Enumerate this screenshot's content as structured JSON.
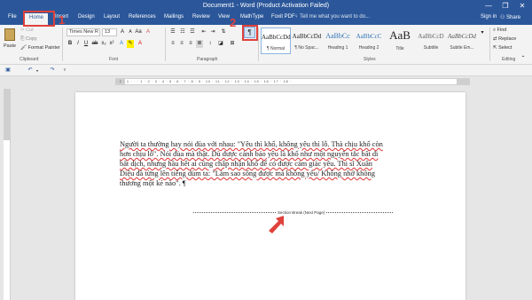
{
  "window": {
    "title": "Document1 - Word (Product Activation Failed)",
    "controls": [
      "—",
      "❐",
      "✕"
    ]
  },
  "tabs": [
    "File",
    "Home",
    "Insert",
    "Design",
    "Layout",
    "References",
    "Mailings",
    "Review",
    "View",
    "MathType",
    "Foxit PDF"
  ],
  "tell_me": "Tell me what you want to do...",
  "account": {
    "sign_in": "Sign in",
    "share": "Share"
  },
  "clipboard": {
    "paste": "Paste",
    "cut": "Cut",
    "copy": "Copy",
    "format_painter": "Format Painter",
    "label": "Clipboard"
  },
  "font": {
    "name": "Times New R",
    "size": "13",
    "label": "Font",
    "bold": "B",
    "italic": "I",
    "underline": "U"
  },
  "paragraph": {
    "label": "Paragraph",
    "show_marks": "¶"
  },
  "styles": {
    "label": "Styles",
    "items": [
      {
        "preview": "AaBbCcDd",
        "name": "¶ Normal"
      },
      {
        "preview": "AaBbCcDd",
        "name": "¶ No Spac..."
      },
      {
        "preview": "AaBbCc",
        "name": "Heading 1"
      },
      {
        "preview": "AaBbCcC",
        "name": "Heading 2"
      },
      {
        "preview": "AaB",
        "name": "Title"
      },
      {
        "preview": "AaBbCcD",
        "name": "Subtitle"
      },
      {
        "preview": "AaBbCcDd",
        "name": "Subtle Em..."
      }
    ]
  },
  "editing": {
    "find": "Find",
    "replace": "Replace",
    "select": "Select",
    "label": "Editing"
  },
  "ruler_ticks": "· 2 · 1 · · · 1 · 2 · 3 · 4 · 5 · 6 · 7 · 8 · 9 · 10 · 11 · 12 · 13 · 14 · 15 · 16 · 17 · 18 ·",
  "document": {
    "lines": [
      "Người ta thường hay nói đùa với nhau: \"Yêu thì khổ, không yêu thì lỗ. Thà chịu khổ còn",
      "hơn chịu lỗ\". Nói đùa mà thật. Dù được cảnh báo yêu là khổ như một nguyên tắc bất di",
      "bất dịch, nhưng hầu hết ai cũng chấp nhận khổ để có được cảm giác yêu. Thi sĩ Xuân",
      "Diệu đã từng lên tiếng dùm ta: \"Làm sao sống được mà không yêu/ Không nhớ không",
      "thương một kẻ nào\". ¶"
    ],
    "section_break": "Section Break (Next Page)"
  },
  "annotations": {
    "step1": "1",
    "step2": "2",
    "color": "#e0413b"
  }
}
